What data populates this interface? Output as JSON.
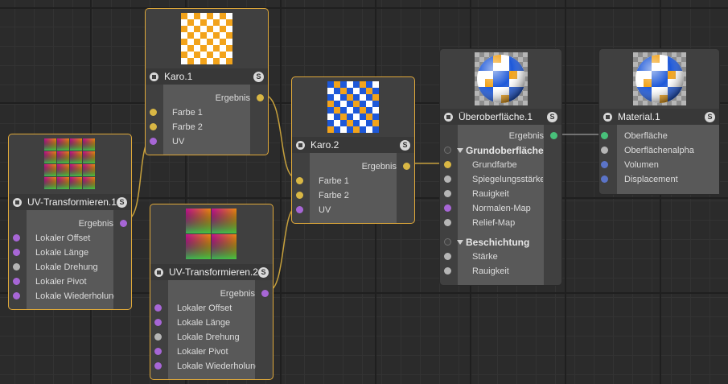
{
  "nodes": {
    "karo1": {
      "title": "Karo.1",
      "badge": "S",
      "output": "Ergebnis",
      "inputs": [
        "Farbe 1",
        "Farbe 2",
        "UV"
      ],
      "checker_colors": [
        "#f2a31b",
        "#ffffff"
      ]
    },
    "karo2": {
      "title": "Karo.2",
      "badge": "S",
      "output": "Ergebnis",
      "inputs": [
        "Farbe 1",
        "Farbe 2",
        "UV"
      ],
      "checker_colors": [
        "#1d58d9",
        "#ffffff",
        "#f2a31b"
      ]
    },
    "uv1": {
      "title": "UV-Transformieren.1",
      "badge": "S",
      "output": "Ergebnis",
      "inputs": [
        "Lokaler Offset",
        "Lokale Länge",
        "Lokale Drehung",
        "Lokaler Pivot",
        "Lokale Wiederholung"
      ]
    },
    "uv2": {
      "title": "UV-Transformieren.2",
      "badge": "S",
      "output": "Ergebnis",
      "inputs": [
        "Lokaler Offset",
        "Lokale Länge",
        "Lokale Drehung",
        "Lokaler Pivot",
        "Lokale Wiederholung"
      ]
    },
    "uber": {
      "title": "Überoberfläche.1",
      "badge": "S",
      "output": "Ergebnis",
      "section1": "Grundoberfläche",
      "section1_inputs": [
        "Grundfarbe",
        "Spiegelungsstärke",
        "Rauigkeit",
        "Normalen-Map",
        "Relief-Map"
      ],
      "section2": "Beschichtung",
      "section2_inputs": [
        "Stärke",
        "Rauigkeit"
      ]
    },
    "material": {
      "title": "Material.1",
      "badge": "S",
      "inputs": [
        "Oberfläche",
        "Oberflächenalpha",
        "Volumen",
        "Displacement"
      ]
    }
  },
  "colors": {
    "selection": "#e0a93a",
    "wire": "#c6a03c",
    "wire_material": "#8a8a8a",
    "port_color": "#d9b744",
    "port_uv": "#a766d6",
    "port_value": "#b5b5b5",
    "port_vector": "#5b74c8",
    "port_material": "#48c07a"
  }
}
